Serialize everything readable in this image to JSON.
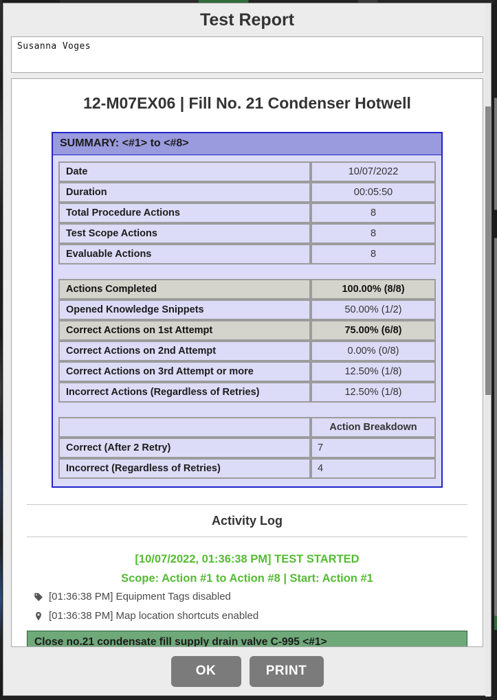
{
  "dialog": {
    "title": "Test Report",
    "user_name": "Susanna  Voges",
    "report_title": "12-M07EX06 | Fill No. 21 Condenser Hotwell"
  },
  "summary": {
    "header": "SUMMARY: <#1> to <#8>",
    "info_rows": [
      {
        "label": "Date",
        "value": "10/07/2022"
      },
      {
        "label": "Duration",
        "value": "00:05:50"
      },
      {
        "label": "Total Procedure Actions",
        "value": "8"
      },
      {
        "label": "Test Scope Actions",
        "value": "8"
      },
      {
        "label": "Evaluable Actions",
        "value": "8"
      }
    ],
    "metric_rows": [
      {
        "label": "Actions Completed",
        "value": "100.00% (8/8)",
        "highlight": true
      },
      {
        "label": "Opened Knowledge Snippets",
        "value": "50.00% (1/2)",
        "highlight": false
      },
      {
        "label": "Correct Actions on 1st Attempt",
        "value": "75.00% (6/8)",
        "highlight": true
      },
      {
        "label": "Correct Actions on 2nd Attempt",
        "value": "0.00% (0/8)",
        "highlight": false
      },
      {
        "label": "Correct Actions on 3rd Attempt or more",
        "value": "12.50% (1/8)",
        "highlight": false
      },
      {
        "label": "Incorrect Actions (Regardless of Retries)",
        "value": "12.50% (1/8)",
        "highlight": false
      }
    ],
    "breakdown": {
      "header_blank": "",
      "header_label": "Action Breakdown",
      "rows": [
        {
          "label": "Correct (After 2 Retry)",
          "value": "7"
        },
        {
          "label": "Incorrect (Regardless of Retries)",
          "value": "4"
        }
      ]
    }
  },
  "activity_log": {
    "title": "Activity Log",
    "started_line1": "[10/07/2022, 01:36:38 PM] TEST STARTED",
    "started_line2": "Scope: Action #1 to Action #8 | Start: Action #1",
    "entries": [
      {
        "icon": "tag-icon",
        "text": "[01:36:38 PM] Equipment Tags disabled"
      },
      {
        "icon": "map-pin-icon",
        "text": "[01:36:38 PM] Map location shortcuts enabled"
      }
    ],
    "current_action": "Close no.21 condensate fill supply drain valve C-995  <#1>"
  },
  "footer": {
    "ok_label": "OK",
    "print_label": "PRINT"
  },
  "colors": {
    "summary_header_bg": "#9a9ade",
    "summary_border": "#2222cc",
    "cell_bg": "#dcdcf8",
    "highlight_bg": "#d4d4cd",
    "log_green": "#55bb33",
    "action_bar_bg": "#6fa97a",
    "button_bg": "#7b7b7b"
  }
}
